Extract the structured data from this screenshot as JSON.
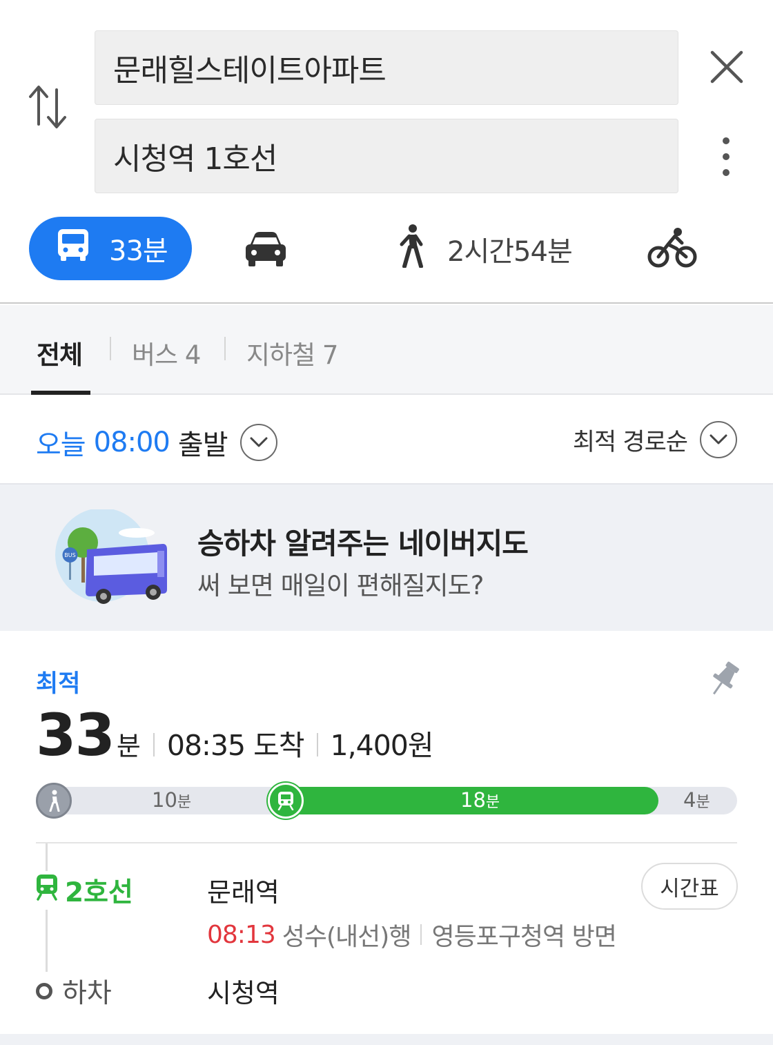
{
  "search": {
    "origin": "문래힐스테이트아파트",
    "destination": "시청역 1호선"
  },
  "modes": {
    "transit_time": "33분",
    "walk_time": "2시간54분"
  },
  "tabs": {
    "all": "전체",
    "bus": "버스 4",
    "subway": "지하철 7"
  },
  "departure": {
    "day": "오늘",
    "time": "08:00",
    "suffix": "출발",
    "sort_label": "최적 경로순"
  },
  "banner": {
    "title": "승하차 알려주는 네이버지도",
    "subtitle": "써 보면 매일이 편해질지도?",
    "art_badge": "BUS"
  },
  "route": {
    "label": "최적",
    "minutes": "33",
    "minutes_unit": "분",
    "arrival": "08:35 도착",
    "fare": "1,400원",
    "segments": [
      {
        "type": "walk",
        "num": "10",
        "unit": "분"
      },
      {
        "type": "subway",
        "num": "18",
        "unit": "분"
      },
      {
        "type": "walk",
        "num": "4",
        "unit": "분"
      }
    ],
    "line_name": "2호선",
    "board_station": "문래역",
    "timetable_label": "시간표",
    "depart_time": "08:13",
    "direction": "성수(내선)행",
    "towards": "영등포구청역 방면",
    "alight_label": "하차",
    "alight_station": "시청역"
  },
  "colors": {
    "accent_blue": "#1e7bf2",
    "line2_green": "#2fb53e",
    "time_red": "#e2363d"
  },
  "icons": [
    "swap-icon",
    "close-icon",
    "more-vertical-icon",
    "bus-icon",
    "car-icon",
    "walk-icon",
    "bike-icon",
    "chevron-down-icon",
    "pin-icon",
    "train-icon"
  ]
}
